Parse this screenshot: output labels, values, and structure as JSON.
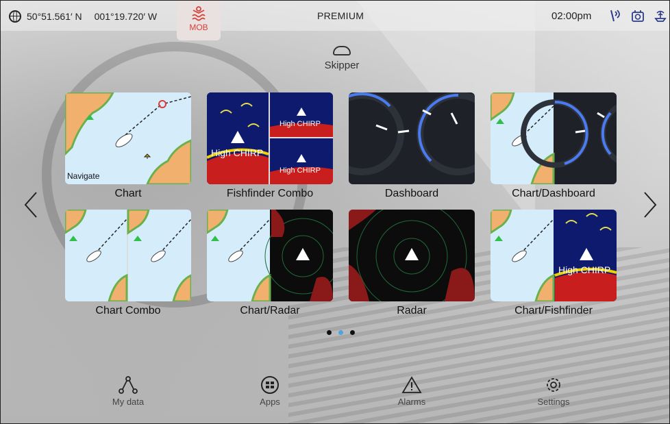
{
  "statusbar": {
    "lat": "50°51.561′ N",
    "lon": "001°19.720′ W",
    "mob_label": "MOB",
    "center_title": "PREMIUM",
    "time": "02:00pm",
    "icons": [
      "globe-icon",
      "mob-icon",
      "gps-signal-icon",
      "autopilot-icon",
      "ais-icon"
    ]
  },
  "profile": {
    "name": "Skipper",
    "icon": "helm-icon"
  },
  "tiles": [
    {
      "label": "Chart",
      "overlay": "Navigate"
    },
    {
      "label": "Fishfinder Combo",
      "warning": "High CHIRP"
    },
    {
      "label": "Dashboard"
    },
    {
      "label": "Chart/Dashboard"
    },
    {
      "label": "Chart Combo"
    },
    {
      "label": "Chart/Radar"
    },
    {
      "label": "Radar"
    },
    {
      "label": "Chart/Fishfinder",
      "warning": "High CHIRP"
    }
  ],
  "pagination": {
    "pages": 3,
    "current": 2
  },
  "bottom_nav": [
    {
      "label": "My data",
      "icon": "my-data-icon"
    },
    {
      "label": "Apps",
      "icon": "apps-icon"
    },
    {
      "label": "Alarms",
      "icon": "alarms-icon"
    },
    {
      "label": "Settings",
      "icon": "settings-icon"
    }
  ],
  "colors": {
    "accent": "#4fa3e0",
    "mob": "#d8403a",
    "dark_tile": "#1e2228",
    "water": "#d5ecfb",
    "land": "#f2b06e"
  }
}
